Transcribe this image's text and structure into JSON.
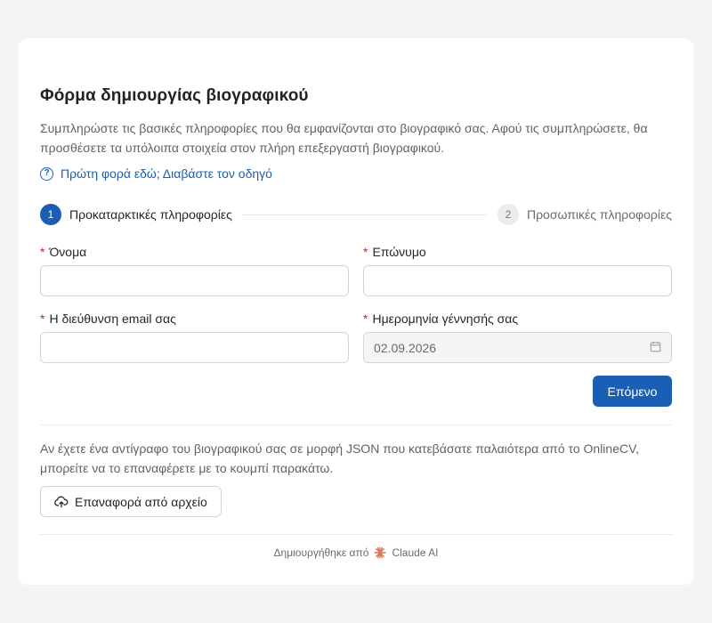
{
  "form": {
    "title": "Φόρμα δημιουργίας βιογραφικού",
    "description": "Συμπληρώστε τις βασικές πληροφορίες που θα εμφανίζονται στο βιογραφικό σας. Αφού τις συμπληρώσετε, θα προσθέσετε τα υπόλοιπα στοιχεία στον πλήρη επεξεργαστή βιογραφικού.",
    "guide_link": "Πρώτη φορά εδώ; Διαβάστε τον οδηγό",
    "guide_icon": "question-circle-icon"
  },
  "steps": [
    {
      "number": "1",
      "label": "Προκαταρκτικές πληροφορίες",
      "state": "active"
    },
    {
      "number": "2",
      "label": "Προσωπικές πληροφορίες",
      "state": "pending"
    }
  ],
  "fields": {
    "first_name": {
      "label": "Όνομα",
      "required": "*",
      "value": ""
    },
    "last_name": {
      "label": "Επώνυμο",
      "required": "*",
      "value": ""
    },
    "email": {
      "label": "Η διεύθυνση email σας",
      "required": "*",
      "value": ""
    },
    "birthdate": {
      "label": "Ημερομηνία γέννησής σας",
      "required": "*",
      "value": "02.09.2026",
      "icon": "calendar-icon"
    }
  },
  "actions": {
    "next_label": "Επόμενο",
    "restore_text": "Αν έχετε ένα αντίγραφο του βιογραφικού σας σε μορφή JSON που κατεβάσατε παλαιότερα από το OnlineCV, μπορείτε να το επαναφέρετε με το κουμπί παρακάτω.",
    "restore_label": "Επαναφορά από αρχείο",
    "restore_icon": "cloud-upload-icon"
  },
  "footer": {
    "created_by": "Δημιουργήθηκε από",
    "brand": "Claude AI",
    "brand_icon": "claude-sparkle-icon"
  },
  "colors": {
    "accent": "#1a5fb4",
    "required": "#c62828",
    "brand": "#d97757",
    "page_bg": "#f4f4f4"
  }
}
